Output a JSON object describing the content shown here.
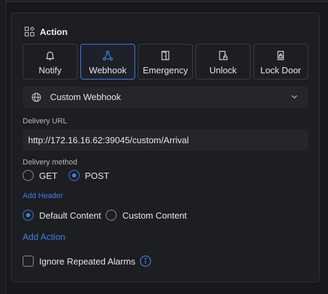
{
  "section": {
    "title": "Action"
  },
  "action_tabs": [
    {
      "label": "Notify",
      "icon": "bell-icon"
    },
    {
      "label": "Webhook",
      "icon": "webhook-icon",
      "selected": true
    },
    {
      "label": "Emergency",
      "icon": "door-open-icon"
    },
    {
      "label": "Unlock",
      "icon": "unlock-door-icon"
    },
    {
      "label": "Lock Door",
      "icon": "lock-door-icon"
    }
  ],
  "webhook_type": {
    "value": "Custom Webhook",
    "icon": "globe-icon"
  },
  "delivery_url": {
    "label": "Delivery URL",
    "value": "http://172.16.16.62:39045/custom/Arrival"
  },
  "delivery_method": {
    "label": "Delivery method",
    "options": [
      {
        "label": "GET",
        "selected": false
      },
      {
        "label": "POST",
        "selected": true
      }
    ]
  },
  "add_header_label": "Add Header",
  "content_mode": {
    "options": [
      {
        "label": "Default Content",
        "selected": true
      },
      {
        "label": "Custom Content",
        "selected": false
      }
    ]
  },
  "add_action_label": "Add Action",
  "ignore_repeated": {
    "label": "Ignore Repeated Alarms",
    "checked": false
  },
  "colors": {
    "accent": "#3f7de8",
    "background": "#17181b",
    "panel": "#1d1e21",
    "field": "#25262a"
  }
}
